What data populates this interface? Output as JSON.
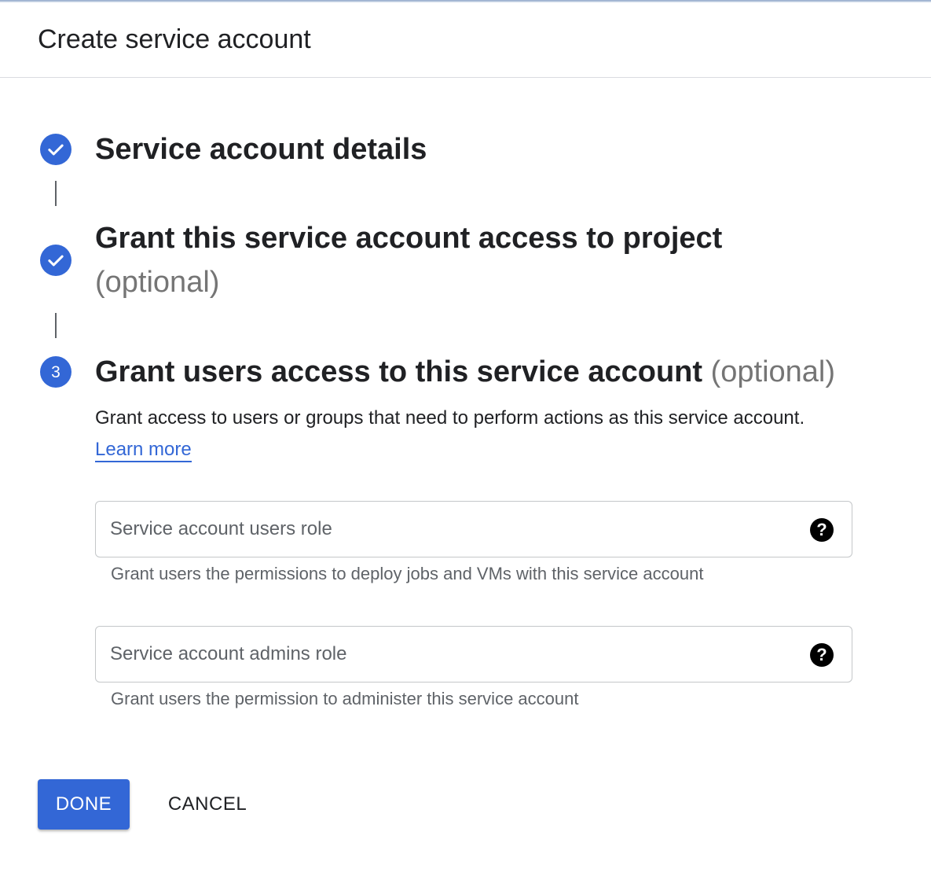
{
  "header": {
    "title": "Create service account"
  },
  "steps": [
    {
      "title": "Service account details",
      "state": "completed",
      "icon": "check-icon"
    },
    {
      "title": "Grant this service account access to project",
      "optional_label": "(optional)",
      "state": "completed",
      "icon": "check-icon"
    },
    {
      "number": "3",
      "title": "Grant users access to this service account",
      "optional_label": "(optional)",
      "state": "active",
      "description": "Grant access to users or groups that need to perform actions as this service account.",
      "learn_more": "Learn more"
    }
  ],
  "fields": {
    "users_role": {
      "placeholder": "Service account users role",
      "value": "",
      "hint": "Grant users the permissions to deploy jobs and VMs with this service account",
      "icon": "help-icon"
    },
    "admins_role": {
      "placeholder": "Service account admins role",
      "value": "",
      "hint": "Grant users the permission to administer this service account",
      "icon": "help-icon"
    }
  },
  "actions": {
    "done_label": "DONE",
    "cancel_label": "CANCEL"
  },
  "colors": {
    "accent": "#3367d6",
    "text": "#202124",
    "muted": "#757575",
    "border": "#c4c7c9"
  }
}
